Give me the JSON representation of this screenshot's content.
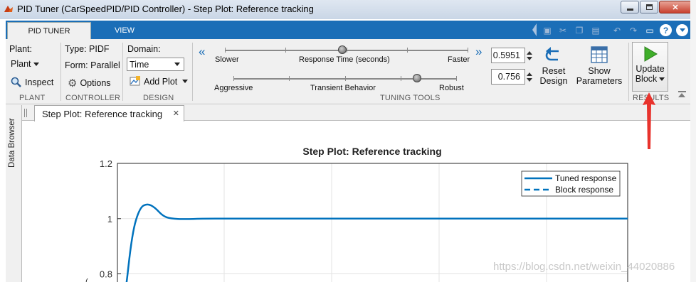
{
  "window": {
    "title": "PID Tuner (CarSpeedPID/PID Controller) - Step Plot: Reference tracking"
  },
  "tabs": [
    "PID TUNER",
    "VIEW"
  ],
  "plant": {
    "label": "Plant:",
    "value": "Plant",
    "inspect": "Inspect",
    "section": "PLANT"
  },
  "controller": {
    "type": "Type: PIDF",
    "form": "Form: Parallel",
    "options": "Options",
    "section": "CONTROLLER"
  },
  "design": {
    "domain_label": "Domain:",
    "domain_value": "Time",
    "add_plot": "Add Plot",
    "section": "DESIGN"
  },
  "tuning": {
    "section": "TUNING TOOLS",
    "response_slider": {
      "left": "Slower",
      "center": "Response Time (seconds)",
      "right": "Faster",
      "value": "0.5951"
    },
    "transient_slider": {
      "left": "Aggressive",
      "center": "Transient Behavior",
      "right": "Robust",
      "value": "0.756"
    },
    "reset_line1": "Reset",
    "reset_line2": "Design",
    "show_line1": "Show",
    "show_line2": "Parameters"
  },
  "results": {
    "update_line1": "Update",
    "update_line2": "Block",
    "section": "RESULTS"
  },
  "left_panel": {
    "data_browser": "Data Browser"
  },
  "doc_tab": {
    "label": "Step Plot: Reference tracking"
  },
  "colors": {
    "accent": "#1b6eb7",
    "series": "#0072bd",
    "annotation_arrow": "#e8332d"
  },
  "chart_data": {
    "type": "line",
    "title": "Step Plot: Reference tracking",
    "ylim": [
      0.75,
      1.2
    ],
    "y_ticks": [
      "1.2",
      "1",
      "0.8"
    ],
    "grid": true,
    "legend_position": "top-right",
    "series": [
      {
        "name": "Tuned response",
        "style": "solid",
        "x": [
          0,
          0.05,
          0.1,
          0.15,
          0.2,
          0.25,
          0.3,
          0.4,
          0.5,
          0.7,
          1.0,
          2.0,
          5.0
        ],
        "y": [
          0.7,
          0.95,
          1.04,
          1.055,
          1.04,
          1.01,
          1.0,
          0.998,
          1.0,
          1.0,
          1.0,
          1.0,
          1.0
        ]
      },
      {
        "name": "Block response",
        "style": "dashed",
        "x": [],
        "y": []
      }
    ]
  },
  "watermark": "https://blog.csdn.net/weixin_44020886"
}
